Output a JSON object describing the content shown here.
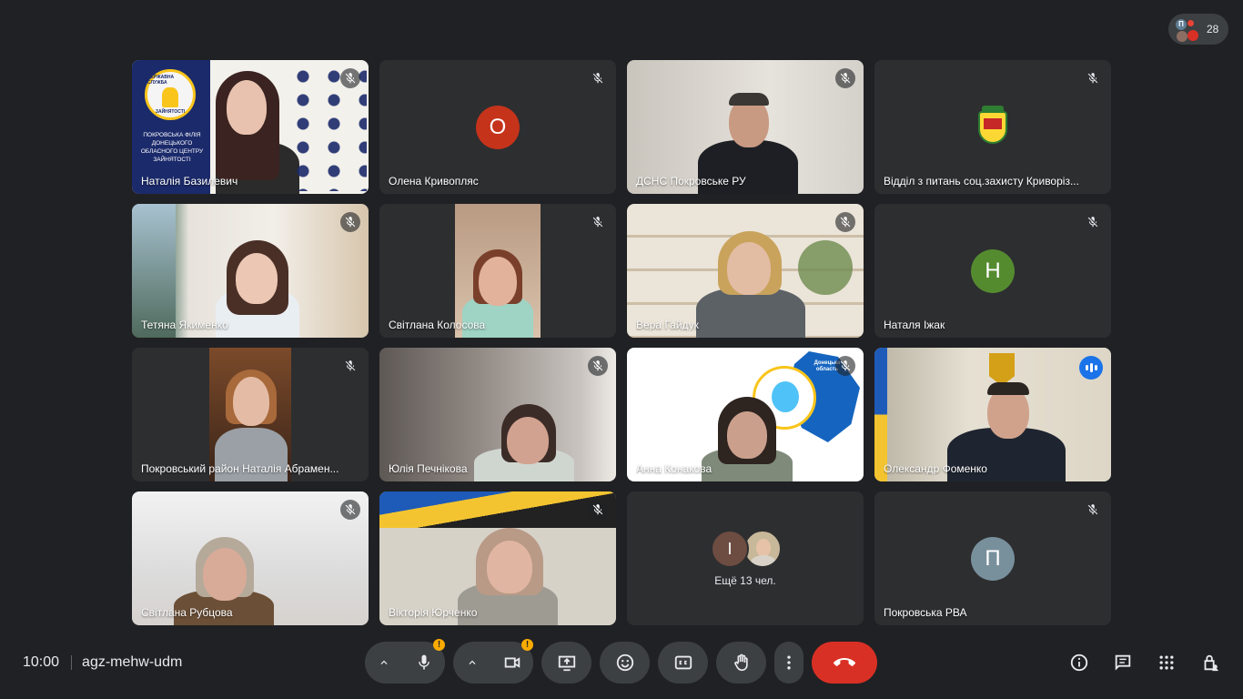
{
  "participant_count": "28",
  "participant_initial": "П",
  "participants": [
    {
      "name": "Наталія Базилевич",
      "muted": true,
      "type": "video"
    },
    {
      "name": "Олена Кривопляс",
      "muted": true,
      "type": "avatar",
      "initial": "О",
      "color": "#c5331b"
    },
    {
      "name": "ДСНС Покровське РУ",
      "muted": true,
      "type": "video"
    },
    {
      "name": "Відділ з питань соц.захисту Криворіз...",
      "muted": true,
      "type": "logo"
    },
    {
      "name": "Тетяна Якименко",
      "muted": true,
      "type": "video"
    },
    {
      "name": "Світлана Колосова",
      "muted": true,
      "type": "video"
    },
    {
      "name": "Вера Гайдук",
      "muted": true,
      "type": "video"
    },
    {
      "name": "Наталя Іжак",
      "muted": true,
      "type": "avatar",
      "initial": "Н",
      "color": "#558b2f"
    },
    {
      "name": "Покровський район Наталія Абрамен...",
      "muted": true,
      "type": "video"
    },
    {
      "name": "Юлія Печнікова",
      "muted": true,
      "type": "video"
    },
    {
      "name": "Анна Конакова",
      "muted": true,
      "type": "video"
    },
    {
      "name": "Олександр Фоменко",
      "muted": false,
      "type": "video",
      "speaking": true
    },
    {
      "name": "Світлана Рубцова",
      "muted": true,
      "type": "video"
    },
    {
      "name": "Вікторія Юрченко",
      "muted": true,
      "type": "video"
    },
    {
      "name": "Покровська РВА",
      "muted": true,
      "type": "avatar",
      "initial": "П",
      "color": "#78909c"
    }
  ],
  "tile1_poster": {
    "org_line1": "ДЕРЖАВНА СЛУЖБА",
    "org_line2": "ЗАЙНЯТОСТІ",
    "caption": "ПОКРОВСЬКА ФІЛІЯ ДОНЕЦЬКОГО ОБЛАСНОГО ЦЕНТРУ ЗАЙНЯТОСТІ"
  },
  "tile11_map_label": "Донецька область",
  "more": {
    "initial": "І",
    "label": "Ещё 13 чел."
  },
  "footer": {
    "time": "10:00",
    "meeting_code": "agz-mehw-udm"
  },
  "warn_mark": "!",
  "colors": {
    "background": "#202124",
    "tile": "#3c4043",
    "end_call": "#d93025",
    "speaking": "#8ab4f8",
    "warning": "#f9ab00"
  }
}
